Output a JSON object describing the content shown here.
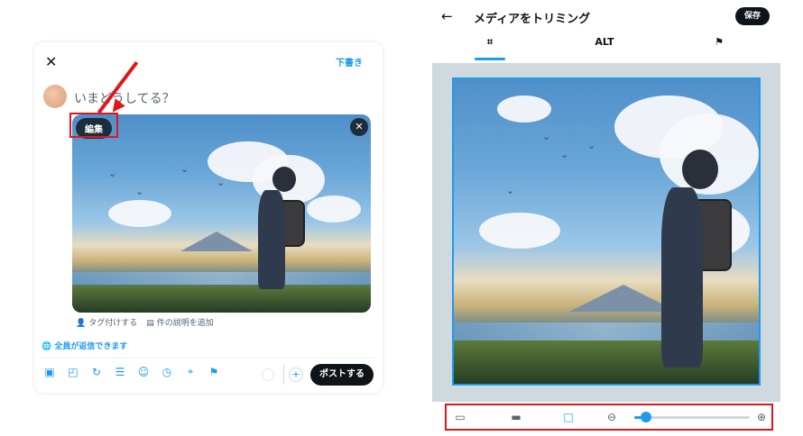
{
  "composer": {
    "close_icon": "close-icon",
    "draft_label": "下書き",
    "prompt_placeholder": "いまどうしてる？",
    "edit_label": "編集",
    "media_close_icon": "close-icon",
    "tag_label": "タグ付けする",
    "description_label": "件の説明を追加",
    "reply_label": "全員が返信できます",
    "post_label": "ポストする",
    "toolbar_icons": [
      "image-icon",
      "gif-icon",
      "poll-icon",
      "list-icon",
      "emoji-icon",
      "schedule-icon",
      "location-icon",
      "flag-icon"
    ]
  },
  "trim": {
    "title": "メディアをトリミング",
    "save_label": "保存",
    "tabs": [
      {
        "label": "",
        "icon": "crop-icon"
      },
      {
        "label": "ALT",
        "icon": ""
      },
      {
        "label": "",
        "icon": "flag-icon"
      }
    ],
    "zoom_level": 0.1,
    "aspect_icons": [
      "aspect-original-icon",
      "aspect-wide-icon",
      "aspect-square-icon"
    ]
  },
  "colors": {
    "accent": "#1d9bf0",
    "highlight": "#e0161d",
    "dark": "#0f1419"
  }
}
